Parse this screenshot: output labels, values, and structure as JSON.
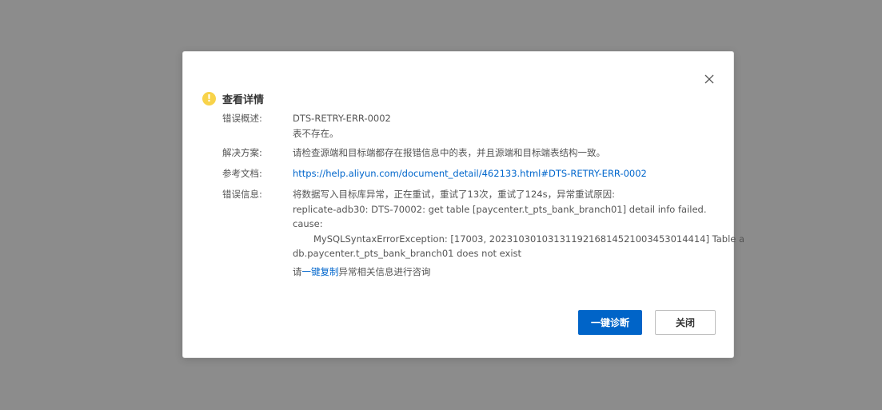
{
  "dialog": {
    "title": "查看详情",
    "icon": "warning-icon",
    "accent_color": "#f8d34a"
  },
  "details": {
    "summary_label": "错误概述:",
    "summary_code": "DTS-RETRY-ERR-0002",
    "summary_text": "表不存在。",
    "solution_label": "解决方案:",
    "solution_text": "请检查源端和目标端都存在报错信息中的表，并且源端和目标端表结构一致。",
    "doc_label": "参考文档:",
    "doc_link": "https://help.aliyun.com/document_detail/462133.html#DTS-RETRY-ERR-0002",
    "error_label": "错误信息:",
    "error_line1": "将数据写入目标库异常，正在重试，重试了13次，重试了124s，异常重试原因:",
    "error_line2": "replicate-adb30: DTS-70002: get table [paycenter.t_pts_bank_branch01] detail info failed.",
    "error_line3": "cause:",
    "error_line4": "MySQLSyntaxErrorException: [17003, 2023103010313119216814521003453014414] Table a",
    "error_line5": "db.paycenter.t_pts_bank_branch01 does not exist"
  },
  "hint": {
    "prefix": "请",
    "link": "一键复制",
    "suffix": "异常相关信息进行咨询"
  },
  "buttons": {
    "diagnose": "一键诊断",
    "close": "关闭"
  },
  "colors": {
    "primary": "#0064c8",
    "link": "#0066cc",
    "overlay": "#8c8c8c"
  }
}
